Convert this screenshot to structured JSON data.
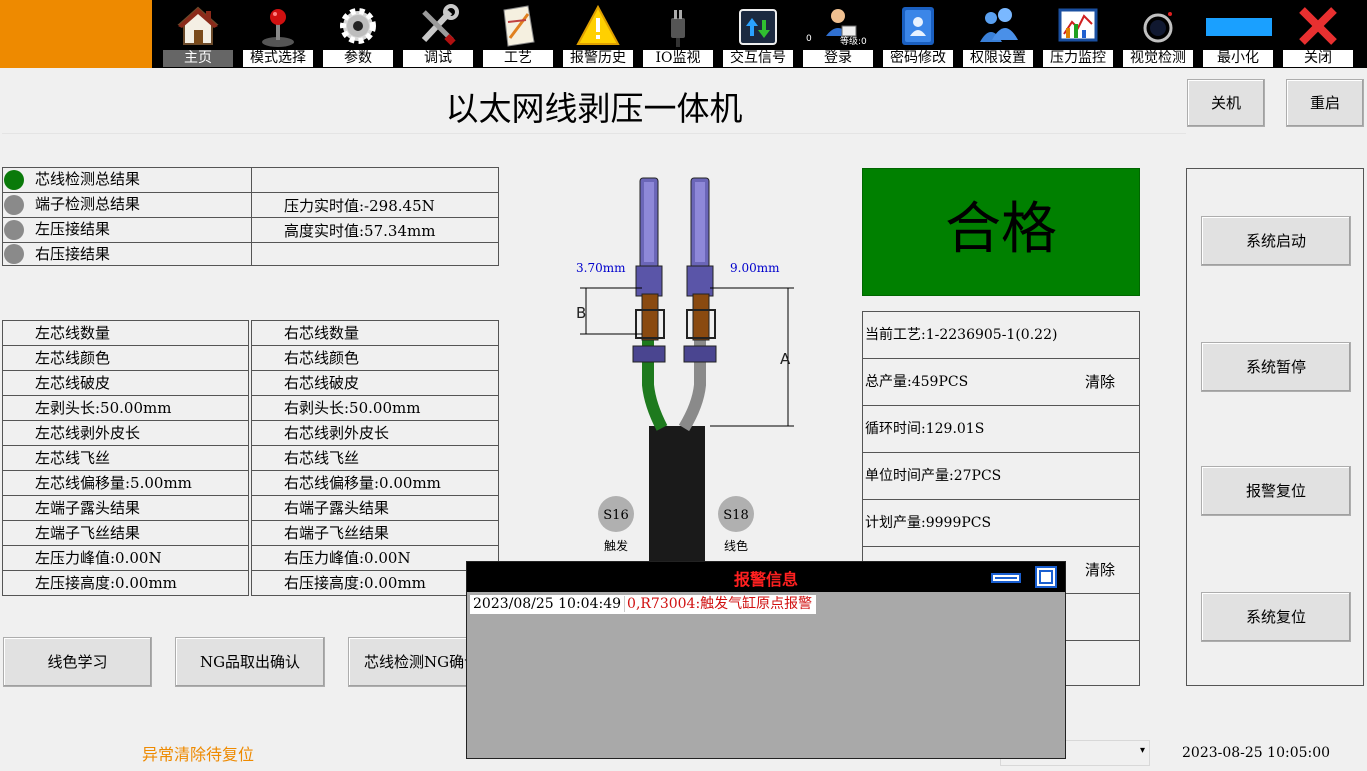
{
  "toolbar": {
    "items": [
      {
        "label": "主页",
        "icon": "home-icon"
      },
      {
        "label": "模式选择",
        "icon": "joystick-icon"
      },
      {
        "label": "参数",
        "icon": "gear-icon"
      },
      {
        "label": "调试",
        "icon": "tools-icon"
      },
      {
        "label": "工艺",
        "icon": "craft-doc-icon"
      },
      {
        "label": "报警历史",
        "icon": "warning-icon"
      },
      {
        "label": "IO监视",
        "icon": "plug-icon"
      },
      {
        "label": "交互信号",
        "icon": "transfer-icon"
      },
      {
        "label": "登录",
        "icon": "user-login-icon"
      },
      {
        "label": "密码修改",
        "icon": "contacts-book-icon"
      },
      {
        "label": "权限设置",
        "icon": "users-icon"
      },
      {
        "label": "压力监控",
        "icon": "chart-monitor-icon"
      },
      {
        "label": "视觉检测",
        "icon": "camera-icon"
      },
      {
        "label": "最小化",
        "icon": "minimize-bar-icon"
      },
      {
        "label": "关闭",
        "icon": "close-icon"
      }
    ],
    "login_level_value": "0",
    "login_level_label": "等级:0"
  },
  "header": {
    "title": "以太网线剥压一体机",
    "shutdown_label": "关机",
    "restart_label": "重启"
  },
  "status_table": {
    "rows": [
      {
        "label": "芯线检测总结果",
        "value": ""
      },
      {
        "label": "端子检测总结果",
        "value": "压力实时值:-298.45N"
      },
      {
        "label": "左压接结果",
        "value": "高度实时值:57.34mm"
      },
      {
        "label": "右压接结果",
        "value": ""
      }
    ]
  },
  "detail_table": {
    "left": [
      "左芯线数量",
      "左芯线颜色",
      "左芯线破皮",
      "左剥头长:50.00mm",
      "左芯线剥外皮长",
      "左芯线飞丝",
      "左芯线偏移量:5.00mm",
      "左端子露头结果",
      "左端子飞丝结果",
      "左压力峰值:0.00N",
      "左压接高度:0.00mm"
    ],
    "right": [
      "右芯线数量",
      "右芯线颜色",
      "右芯线破皮",
      "右剥头长:50.00mm",
      "右芯线剥外皮长",
      "右芯线飞丝",
      "右芯线偏移量:0.00mm",
      "右端子露头结果",
      "右端子飞丝结果",
      "右压力峰值:0.00N",
      "右压接高度:0.00mm"
    ]
  },
  "diagram": {
    "left_dim": "3.70mm",
    "right_dim": "9.00mm",
    "label_a": "A",
    "label_b": "B",
    "sensor_left": "S16",
    "sensor_left_caption": "触发",
    "sensor_right": "S18",
    "sensor_right_caption": "线色"
  },
  "result": {
    "text": "合格",
    "color": "#008000"
  },
  "info": {
    "process": "当前工艺:1-2236905-1(0.22)",
    "total": "总产量:459PCS",
    "clear1": "清除",
    "cycle": "循环时间:129.01S",
    "unit_output": "单位时间产量:27PCS",
    "planned": "计划产量:9999PCS",
    "clear2": "清除"
  },
  "controls": {
    "start": "系统启动",
    "pause": "系统暂停",
    "alarm_reset": "报警复位",
    "system_reset": "系统复位"
  },
  "bottom_buttons": {
    "color_learn": "线色学习",
    "ng_confirm": "NG品取出确认",
    "core_ng_confirm": "芯线检测NG确认"
  },
  "alarm": {
    "title": "报警信息",
    "time": "2023/08/25 10:04:49",
    "message": "0,R73004:触发气缸原点报警"
  },
  "status_text": "异常清除待复位",
  "clock": "2023-08-25 10:05:00",
  "colors": {
    "brand_orange": "#ee8a00",
    "pass_green": "#008000",
    "alarm_red": "#ff2020",
    "dim_blue": "#0000cc"
  }
}
